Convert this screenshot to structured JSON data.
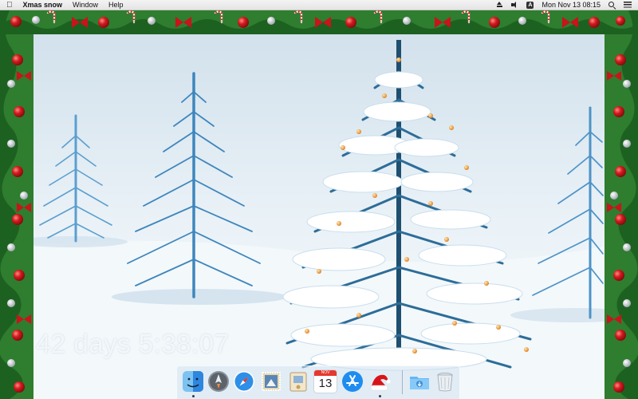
{
  "menubar": {
    "app_name": "Xmas snow",
    "menus": [
      "Window",
      "Help"
    ],
    "clock": "Mon Nov 13  08:15",
    "input_source": "A"
  },
  "wallpaper": {
    "countdown": "42 days 5:38:07"
  },
  "dock": {
    "calendar_month": "NOV",
    "calendar_day": "13",
    "items": [
      "finder-icon",
      "launchpad-icon",
      "safari-icon",
      "mail-icon",
      "contacts-icon",
      "calendar-icon",
      "app-store-icon",
      "xmas-snow-app-icon",
      "downloads-folder-icon",
      "trash-icon"
    ]
  },
  "colors": {
    "holly_green": "#2f7d2f",
    "berry_red": "#c8141a",
    "tree_blue": "#4f93c4"
  }
}
